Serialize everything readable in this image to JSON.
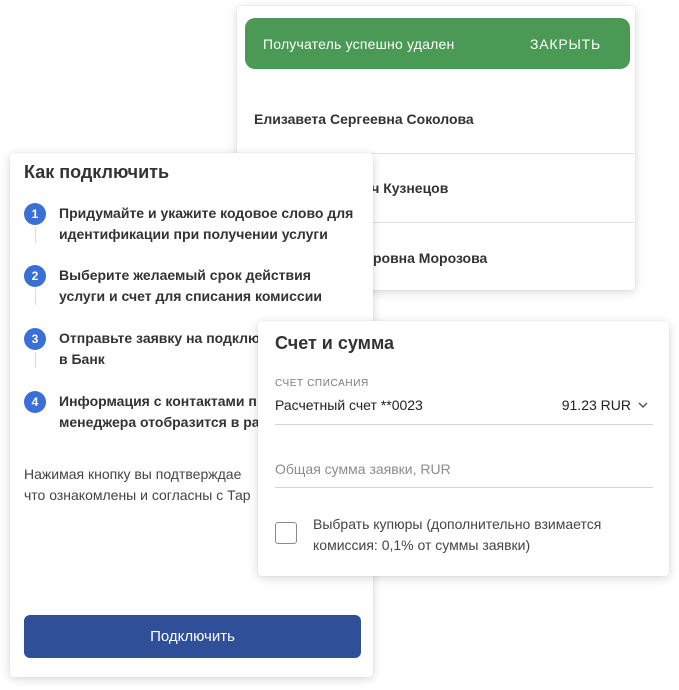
{
  "recipients": {
    "snackbar": {
      "text": "Получатель успешно удален",
      "close_label": "ЗАКРЫТЬ"
    },
    "items": [
      {
        "name": "Елизавета Сергеевна Соколова"
      },
      {
        "name": "вич Кузнецов"
      },
      {
        "name": "мировна Морозова"
      }
    ]
  },
  "connect": {
    "title": "Как подключить",
    "steps": [
      {
        "number": "1",
        "text": "Придумайте и укажите кодовое слово для\nидентификации при получении услуги"
      },
      {
        "number": "2",
        "text": "Выберите желаемый срок действия\nуслуги и счет для списания комиссии"
      },
      {
        "number": "3",
        "text": "Отправьте заявку на подклю\nв Банк"
      },
      {
        "number": "4",
        "text": "Информация с контактами п\nменеджера отобразится в ра"
      }
    ],
    "note": "Нажимая кнопку вы подтверждае\nчто ознакомлены и согласны с Тар",
    "button_label": "Подключить"
  },
  "account": {
    "title": "Счет и сумма",
    "field_label": "СЧЕТ СПИСАНИЯ",
    "account_name": "Расчетный счет **0023",
    "account_amount": "91.23 RUR",
    "sum_placeholder": "Общая сумма заявки, RUR",
    "checkbox_label": "Выбрать купюры (дополнительно взимается\nкомиссия: 0,1% от суммы заявки)"
  },
  "colors": {
    "accent": "#3b6fd8",
    "button": "#2f4f98",
    "success": "#4a9a56"
  }
}
